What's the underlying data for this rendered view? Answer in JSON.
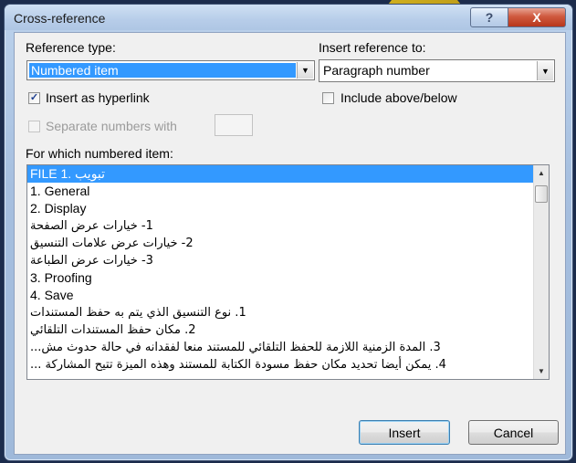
{
  "window": {
    "title": "Cross-reference",
    "help_glyph": "?",
    "close_glyph": "X"
  },
  "reference_type": {
    "label": "Reference type:",
    "value": "Numbered item"
  },
  "insert_reference_to": {
    "label": "Insert reference to:",
    "value": "Paragraph number"
  },
  "insert_as_hyperlink": {
    "label": "Insert as hyperlink",
    "checked": true
  },
  "include_above_below": {
    "label": "Include above/below",
    "checked": false
  },
  "separate_numbers": {
    "label": "Separate numbers with",
    "enabled": false
  },
  "list": {
    "label": "For which numbered item:",
    "items": [
      {
        "text": "FILE تبويب .1",
        "selected": true,
        "rtl": false
      },
      {
        "text": "1. General",
        "selected": false,
        "rtl": false
      },
      {
        "text": "2. Display",
        "selected": false,
        "rtl": false
      },
      {
        "text": "1- خيارات عرض الصفحة",
        "selected": false,
        "rtl": true
      },
      {
        "text": "2- خيارات عرض علامات  التنسيق",
        "selected": false,
        "rtl": true
      },
      {
        "text": "3- خيارات عرض الطباعة",
        "selected": false,
        "rtl": true
      },
      {
        "text": "3. Proofing",
        "selected": false,
        "rtl": false
      },
      {
        "text": "4. Save",
        "selected": false,
        "rtl": false
      },
      {
        "text": "1. نوع التنسيق الذي يتم به حفظ المستندات",
        "selected": false,
        "rtl": true
      },
      {
        "text": "2. مكان حفظ المستندات التلقائي",
        "selected": false,
        "rtl": true
      },
      {
        "text": "3. المدة الزمنية اللازمة للحفظ التلقائي للمستند منعا لفقدانه في حالة حدوث مش...",
        "selected": false,
        "rtl": true
      },
      {
        "text": "4. يمكن أيضا تحديد مكان حفظ مسودة الكتابة للمستند وهذه الميزة تتيح المشاركة ...",
        "selected": false,
        "rtl": true
      }
    ]
  },
  "buttons": {
    "insert": "Insert",
    "cancel": "Cancel"
  }
}
